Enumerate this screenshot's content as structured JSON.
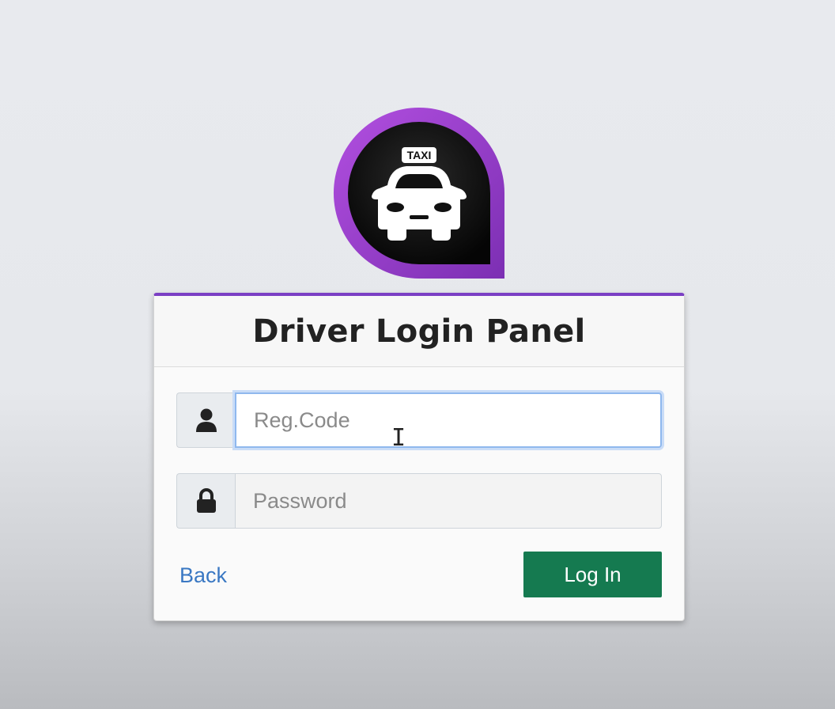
{
  "logo": {
    "icon": "taxi-pin-icon",
    "badge_text": "TAXI",
    "ring_color": "#9b3fd0",
    "inner_color": "#111111"
  },
  "panel": {
    "title": "Driver Login Panel",
    "accent_color": "#7b3fc4"
  },
  "fields": {
    "regcode": {
      "icon": "user-icon",
      "placeholder": "Reg.Code",
      "value": ""
    },
    "password": {
      "icon": "lock-icon",
      "placeholder": "Password",
      "value": ""
    }
  },
  "actions": {
    "back_label": "Back",
    "login_label": "Log In",
    "login_color": "#157a50"
  }
}
